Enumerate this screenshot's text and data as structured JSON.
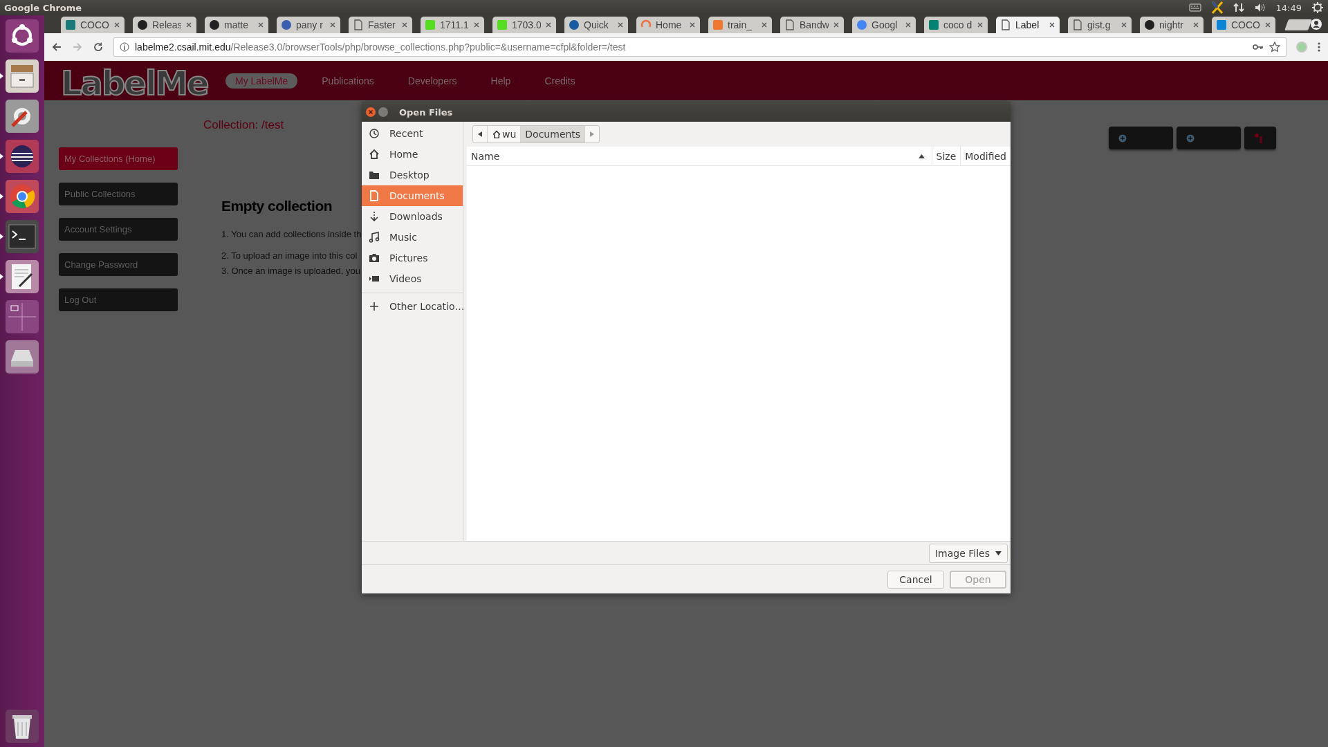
{
  "top_panel": {
    "app_title": "Google Chrome",
    "clock": "14:49"
  },
  "launcher": [
    {
      "kind": "ubuntu",
      "running": false
    },
    {
      "kind": "files",
      "running": true
    },
    {
      "kind": "settings",
      "running": false
    },
    {
      "kind": "eclipse",
      "running": true
    },
    {
      "kind": "chrome",
      "running": true
    },
    {
      "kind": "terminal",
      "running": true
    },
    {
      "kind": "editor",
      "running": true
    },
    {
      "kind": "workspaces",
      "running": false
    },
    {
      "kind": "disk",
      "running": false
    },
    {
      "kind": "trash",
      "running": false
    }
  ],
  "tabs": [
    {
      "label": "COCO",
      "kind": "badge",
      "color": "#1a7a7a",
      "selected": false
    },
    {
      "label": "Releas",
      "kind": "round",
      "color": "#222222",
      "selected": false
    },
    {
      "label": "matte",
      "kind": "round",
      "color": "#222222",
      "selected": false
    },
    {
      "label": "pany r",
      "kind": "round",
      "color": "#3a5fb0",
      "selected": false
    },
    {
      "label": "Faster",
      "kind": "doc",
      "selected": false
    },
    {
      "label": "1711.1",
      "kind": "badge",
      "color": "#55dd22",
      "selected": false
    },
    {
      "label": "1703.0",
      "kind": "badge",
      "color": "#55dd22",
      "selected": false
    },
    {
      "label": "Quick",
      "kind": "round",
      "color": "#1a5aa0",
      "selected": false
    },
    {
      "label": "Home",
      "kind": "ring",
      "color": "#f07040",
      "selected": false
    },
    {
      "label": "train_",
      "kind": "badge",
      "color": "#f07830",
      "selected": false
    },
    {
      "label": "Bandw",
      "kind": "doc",
      "selected": false
    },
    {
      "label": "Googl",
      "kind": "round",
      "color": "#4285f4",
      "selected": false
    },
    {
      "label": "coco d",
      "kind": "badge",
      "color": "#008373",
      "selected": false
    },
    {
      "label": "Label",
      "kind": "doc",
      "selected": true
    },
    {
      "label": "gist.g",
      "kind": "doc",
      "selected": false
    },
    {
      "label": "nightr",
      "kind": "round",
      "color": "#222222",
      "selected": false
    },
    {
      "label": "COCO",
      "kind": "badge",
      "color": "#0a84d6",
      "selected": false
    }
  ],
  "address_bar": {
    "host": "labelme2.csail.mit.edu",
    "path": "/Release3.0/browserTools/php/browse_collections.php?public=&username=cfpl&folder=/test"
  },
  "site": {
    "logo": "LabelMe",
    "nav": [
      {
        "label": "My LabelMe",
        "selected": true
      },
      {
        "label": "Publications",
        "selected": false
      },
      {
        "label": "Developers",
        "selected": false
      },
      {
        "label": "Help",
        "selected": false
      },
      {
        "label": "Credits",
        "selected": false
      }
    ],
    "sidebar": [
      {
        "label": "My Collections (Home)",
        "selected": true
      },
      {
        "label": "Public Collections",
        "selected": false
      },
      {
        "label": "Account Settings",
        "selected": false
      },
      {
        "label": "Change Password",
        "selected": false
      },
      {
        "label": "Log Out",
        "selected": false
      }
    ],
    "collection_title": "Collection: /test",
    "empty_heading": "Empty collection",
    "steps": [
      "1. You can add collections inside th",
      "2. To upload an image into this col",
      "3. Once an image is uploaded, you"
    ]
  },
  "dialog": {
    "title": "Open Files",
    "places": [
      {
        "label": "Recent",
        "kind": "recent",
        "selected": false
      },
      {
        "label": "Home",
        "kind": "home",
        "selected": false
      },
      {
        "label": "Desktop",
        "kind": "desktop",
        "selected": false
      },
      {
        "label": "Documents",
        "kind": "documents",
        "selected": true
      },
      {
        "label": "Downloads",
        "kind": "downloads",
        "selected": false
      },
      {
        "label": "Music",
        "kind": "music",
        "selected": false
      },
      {
        "label": "Pictures",
        "kind": "pictures",
        "selected": false
      },
      {
        "label": "Videos",
        "kind": "videos",
        "selected": false
      },
      {
        "label": "Other Locatio…",
        "kind": "other",
        "selected": false
      }
    ],
    "path": [
      {
        "label": "wu",
        "kind": "home",
        "selected": false
      },
      {
        "label": "Documents",
        "kind": "folder",
        "selected": true
      }
    ],
    "columns": [
      "Name",
      "Size",
      "Modified"
    ],
    "filter": "Image Files",
    "buttons": [
      {
        "label": "Cancel",
        "disabled": false
      },
      {
        "label": "Open",
        "disabled": true
      }
    ]
  }
}
